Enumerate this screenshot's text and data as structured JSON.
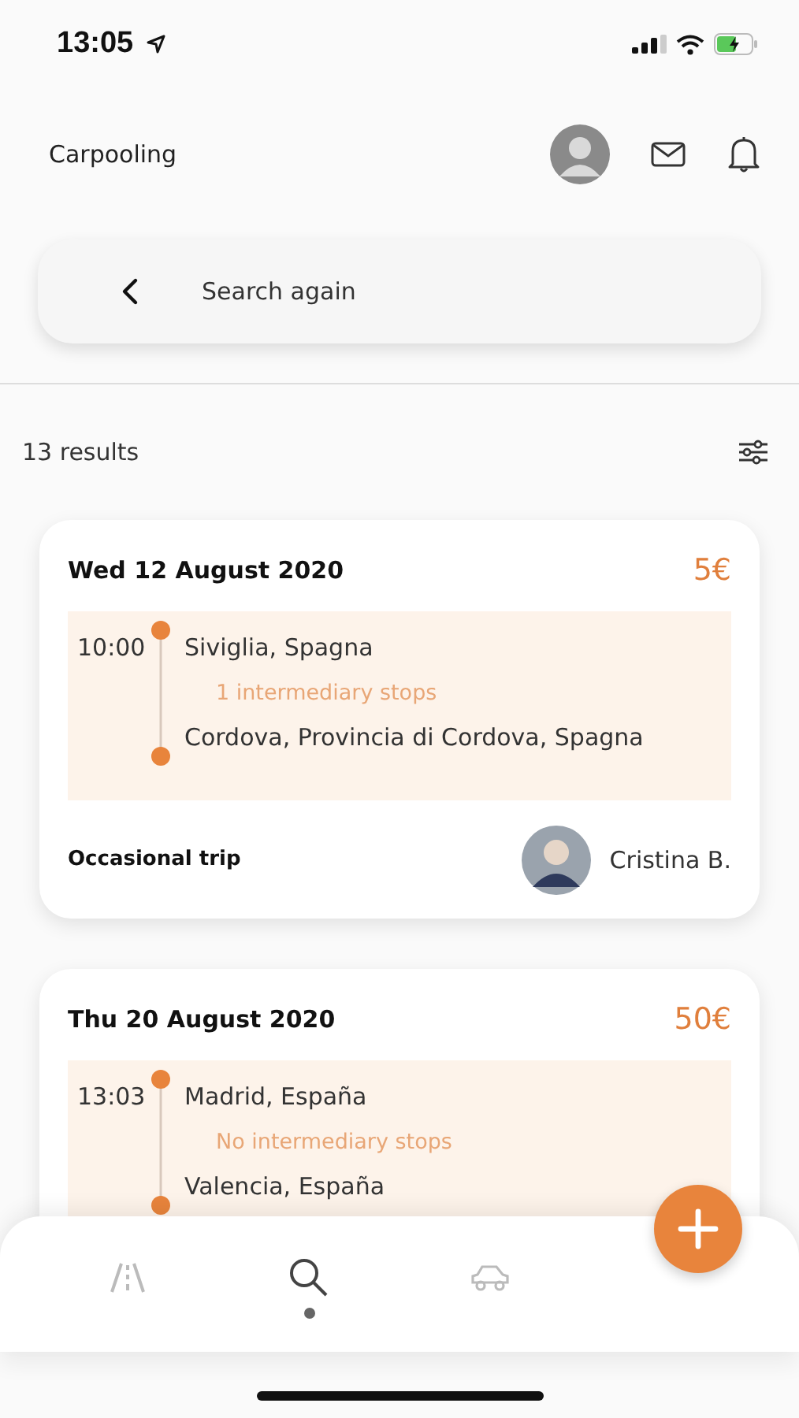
{
  "status_bar": {
    "time": "13:05"
  },
  "header": {
    "title": "Carpooling"
  },
  "search": {
    "label": "Search again"
  },
  "results": {
    "count": "13 results"
  },
  "trips": [
    {
      "date": "Wed 12 August 2020",
      "price": "5€",
      "time": "10:00",
      "from": "Siviglia, Spagna",
      "stops": "1 intermediary stops",
      "to": "Cordova, Provincia di Cordova, Spagna",
      "footer": {
        "type": "Occasional trip",
        "driver": "Cristina B."
      }
    },
    {
      "date": "Thu 20 August 2020",
      "price": "50€",
      "time": "13:03",
      "from": "Madrid, España",
      "stops": "No intermediary stops",
      "to": "Valencia, España"
    }
  ],
  "tabs": [
    {
      "kind": "road",
      "selected": false
    },
    {
      "kind": "search",
      "selected": true
    },
    {
      "kind": "car",
      "selected": false
    }
  ]
}
